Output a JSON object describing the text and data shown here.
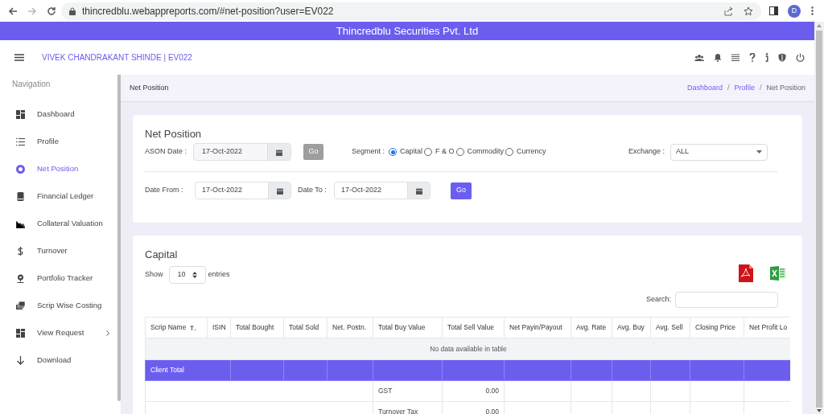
{
  "browser": {
    "url": "thincredblu.webappreports.com/#net-position?user=EV022",
    "avatar": "D"
  },
  "banner": {
    "title": "Thincredblu Securities Pvt. Ltd"
  },
  "header": {
    "user": "VIVEK CHANDRAKANT SHINDE | EV022"
  },
  "sidebar": {
    "heading": "Navigation",
    "items": [
      {
        "label": "Dashboard",
        "selected": false,
        "submenu": false
      },
      {
        "label": "Profile",
        "selected": false,
        "submenu": false
      },
      {
        "label": "Net Position",
        "selected": true,
        "submenu": false
      },
      {
        "label": "Financial Ledger",
        "selected": false,
        "submenu": false
      },
      {
        "label": "Collateral Valuation",
        "selected": false,
        "submenu": false
      },
      {
        "label": "Turnover",
        "selected": false,
        "submenu": false
      },
      {
        "label": "Portfolio Tracker",
        "selected": false,
        "submenu": false
      },
      {
        "label": "Scrip Wise Costing",
        "selected": false,
        "submenu": false
      },
      {
        "label": "View Request",
        "selected": false,
        "submenu": true
      },
      {
        "label": "Download",
        "selected": false,
        "submenu": false
      }
    ]
  },
  "page_title": "Net Position",
  "breadcrumb": [
    {
      "label": "Dashboard",
      "kind": "link"
    },
    {
      "label": "/",
      "kind": "separator"
    },
    {
      "label": "Profile",
      "kind": "link"
    },
    {
      "label": "/",
      "kind": "separator"
    },
    {
      "label": "Net Position",
      "kind": "current"
    }
  ],
  "filters": {
    "title": "Net Position",
    "ason_label": "ASON Date :",
    "ason_value": "17-Oct-2022",
    "go_ason": {
      "label": "Go",
      "disabled": true
    },
    "segment_label": "Segment :",
    "segments": [
      {
        "label": "Capital",
        "selected": true
      },
      {
        "label": "F & O",
        "selected": false
      },
      {
        "label": "Commodity",
        "selected": false
      },
      {
        "label": "Currency",
        "selected": false
      }
    ],
    "exchange_label": "Exchange :",
    "exchange_value": "ALL",
    "from_label": "Date From :",
    "from_value": "17-Oct-2022",
    "to_label": "Date To :",
    "to_value": "17-Oct-2022",
    "go_range": {
      "label": "Go",
      "disabled": false
    }
  },
  "capital": {
    "title": "Capital",
    "show_label": "Show",
    "entries_value": "10",
    "entries_label": "entries",
    "search_label": "Search:",
    "columns": [
      "Scrip Name",
      "ISIN",
      "Total Bought",
      "Total Sold",
      "Net. Postn.",
      "Total Buy Value",
      "Total Sell Value",
      "Net Payin/Payout",
      "Avg. Rate",
      "Avg. Buy",
      "Avg. Sell",
      "Closing Price",
      "Net Profit Lo"
    ],
    "rows": [
      {
        "kind": "empty",
        "text": "No data available in table"
      },
      {
        "kind": "total",
        "text": "Client Total"
      },
      {
        "kind": "tax",
        "label": "GST",
        "value": "0.00"
      },
      {
        "kind": "tax",
        "label": "Turnover Tax",
        "value": "0.00"
      }
    ]
  }
}
